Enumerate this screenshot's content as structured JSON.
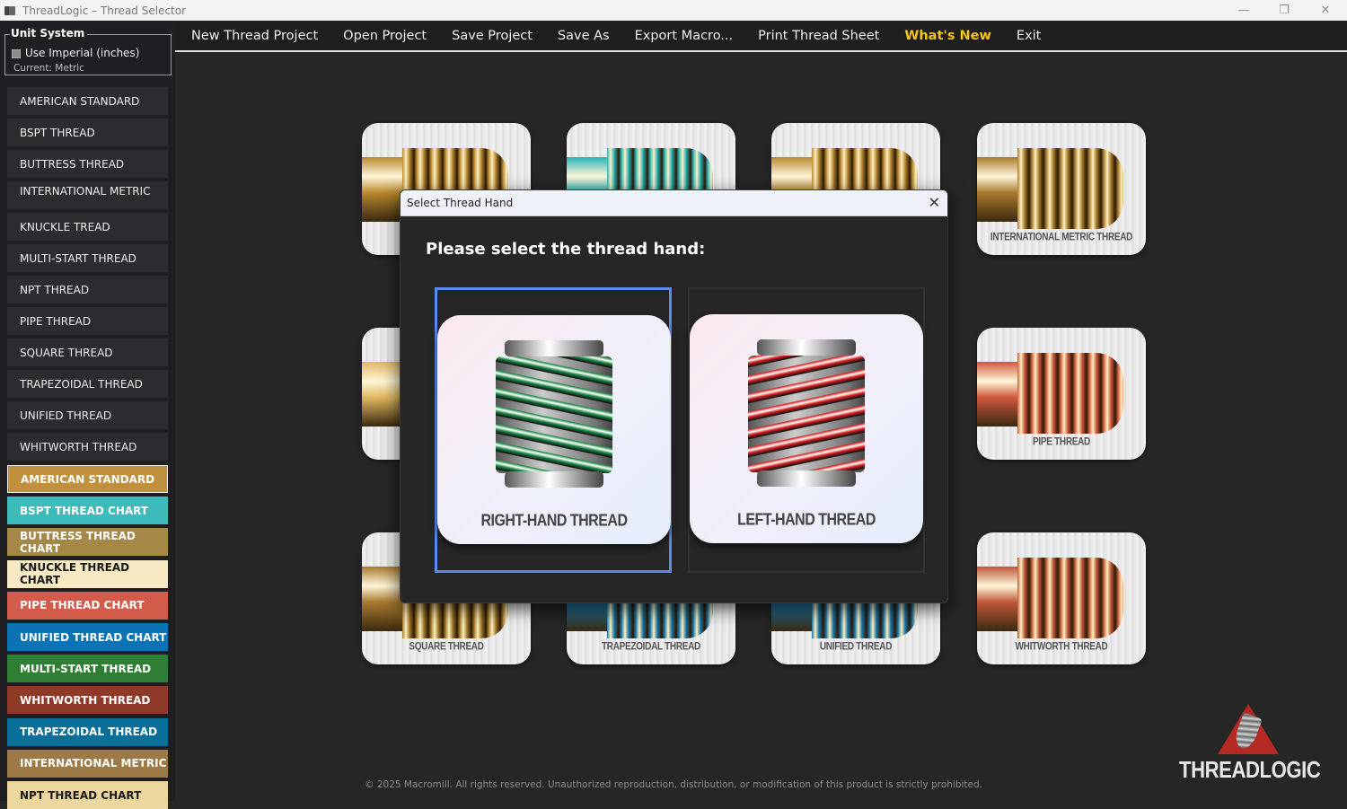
{
  "window": {
    "title": "ThreadLogic – Thread Selector",
    "controls": [
      "—",
      "❐",
      "✕"
    ]
  },
  "unit_system": {
    "legend": "Unit System",
    "checkbox_label": "Use Imperial (inches)",
    "checked": false,
    "current": "Current: Metric"
  },
  "sidebar": {
    "items": [
      "AMERICAN STANDARD",
      "BSPT THREAD",
      "BUTTRESS THREAD",
      "INTERNATIONAL METRIC",
      "KNUCKLE TREAD",
      "MULTI-START THREAD",
      "NPT THREAD",
      "PIPE THREAD",
      "SQUARE THREAD",
      "TRAPEZOIDAL THREAD",
      "UNIFIED THREAD",
      "WHITWORTH THREAD"
    ],
    "chart_buttons": [
      {
        "label": "AMERICAN STANDARD",
        "color": "#c0903e",
        "text": "#ffffff"
      },
      {
        "label": "BSPT THREAD CHART",
        "color": "#3dbbbb",
        "text": "#ffffff"
      },
      {
        "label": "BUTTRESS THREAD CHART",
        "color": "#a58748",
        "text": "#ffffff"
      },
      {
        "label": "KNUCKLE THREAD CHART",
        "color": "#f6e9c4",
        "text": "#1a1a1a"
      },
      {
        "label": "PIPE THREAD CHART",
        "color": "#d35b4a",
        "text": "#ffffff"
      },
      {
        "label": "UNIFIED THREAD CHART",
        "color": "#0b72b3",
        "text": "#ffffff"
      },
      {
        "label": "MULTI-START THREAD",
        "color": "#2e7f33",
        "text": "#ffffff"
      },
      {
        "label": "WHITWORTH THREAD",
        "color": "#8e3a26",
        "text": "#ffffff"
      },
      {
        "label": "TRAPEZOIDAL THREAD",
        "color": "#0a6f99",
        "text": "#ffffff"
      },
      {
        "label": "INTERNATIONAL METRIC",
        "color": "#9d7a45",
        "text": "#ffffff"
      },
      {
        "label": "NPT THREAD CHART",
        "color": "#ecd79f",
        "text": "#1a1a1a"
      }
    ]
  },
  "menu": {
    "items": [
      "New Thread Project",
      "Open Project",
      "Save Project",
      "Save As",
      "Export Macro...",
      "Print Thread Sheet",
      "What's New",
      "Exit"
    ],
    "highlighted": "What's New"
  },
  "cards": [
    {
      "label": "",
      "color": "#b8892e"
    },
    {
      "label": "",
      "color": "#2ab3b8"
    },
    {
      "label": "",
      "color": "#b8892e"
    },
    {
      "label": "INTERNATIONAL METRIC THREAD",
      "color": "#a87a2c"
    },
    {
      "label": "",
      "color": "#e0b860"
    },
    {
      "label": "PIPE THREAD",
      "color": "#d0583e"
    },
    {
      "label": "SQUARE THREAD",
      "color": "#a87a2c"
    },
    {
      "label": "TRAPEZOIDAL THREAD",
      "color": "#1a76a8"
    },
    {
      "label": "UNIFIED THREAD",
      "color": "#1a76a8"
    },
    {
      "label": "WHITWORTH THREAD",
      "color": "#c0583a"
    }
  ],
  "dialog": {
    "title": "Select Thread Hand",
    "prompt": "Please select the thread hand:",
    "options": [
      {
        "label": "RIGHT-HAND THREAD",
        "color": "#1c8a45",
        "selected": true
      },
      {
        "label": "LEFT-HAND THREAD",
        "color": "#d82020",
        "selected": false
      }
    ]
  },
  "footer": "© 2025 Macromill. All rights reserved. Unauthorized reproduction, distribution, or modification of this product is strictly prohibited.",
  "logo": {
    "text": "THREADLOGIC"
  }
}
